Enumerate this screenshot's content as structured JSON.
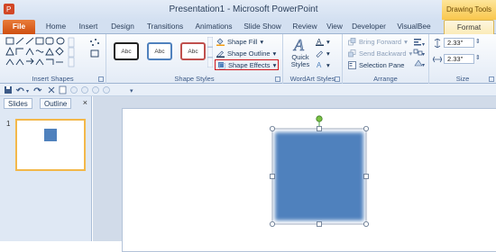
{
  "window": {
    "title": "Presentation1 - Microsoft PowerPoint",
    "context_tab_title": "Drawing Tools"
  },
  "tabs": [
    {
      "label": "File"
    },
    {
      "label": "Home"
    },
    {
      "label": "Insert"
    },
    {
      "label": "Design"
    },
    {
      "label": "Transitions"
    },
    {
      "label": "Animations"
    },
    {
      "label": "Slide Show"
    },
    {
      "label": "Review"
    },
    {
      "label": "View"
    },
    {
      "label": "Developer"
    },
    {
      "label": "VisualBee"
    },
    {
      "label": "Format"
    }
  ],
  "ribbon": {
    "insert_shapes": {
      "label": "Insert Shapes"
    },
    "shape_styles": {
      "label": "Shape Styles",
      "swatches": [
        "Abc",
        "Abc",
        "Abc"
      ],
      "shape_fill": "Shape Fill",
      "shape_outline": "Shape Outline",
      "shape_effects": "Shape Effects"
    },
    "wordart_styles": {
      "label": "WordArt Styles",
      "quick_styles": "Quick Styles"
    },
    "arrange": {
      "label": "Arrange",
      "bring_forward": "Bring Forward",
      "send_backward": "Send Backward",
      "selection_pane": "Selection Pane"
    },
    "size": {
      "label": "Size",
      "height": "2.33\"",
      "width": "2.33\""
    }
  },
  "panel": {
    "tabs": [
      "Slides",
      "Outline"
    ],
    "close": "×",
    "slide_number": "1"
  },
  "colors": {
    "shape_fill": "#4f81bd",
    "file_tab": "#cf4f10",
    "highlight": "#d0161b"
  }
}
